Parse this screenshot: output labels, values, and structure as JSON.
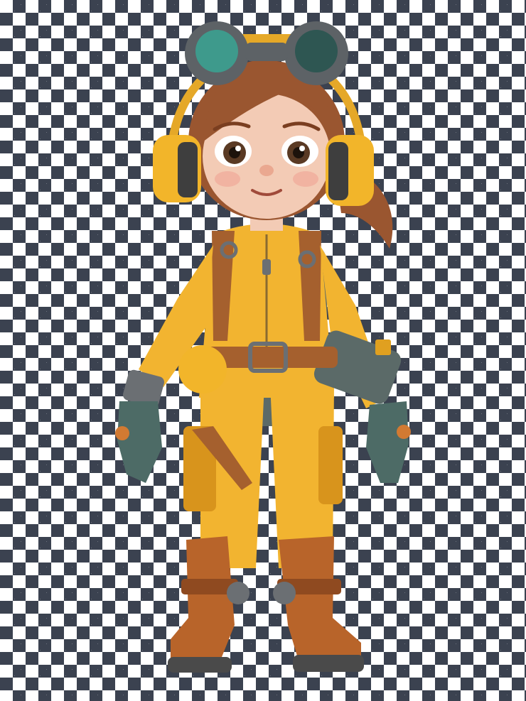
{
  "image": {
    "subject_icon": "character-figure-icon",
    "background_pattern": "checkerboard-transparency",
    "colors": {
      "checker_dark": "#3b4250",
      "checker_light": "#ffffff",
      "suit": "#f2b430",
      "suit_shadow": "#d8941c",
      "hair": "#9a5630",
      "skin": "#f3cbb5",
      "strap": "#a5602e",
      "boot": "#b8642a",
      "glove": "#4d6b66",
      "goggle_frame": "#5d6266",
      "goggle_lens": "#3e9a8c",
      "headphone": "#f2b52a",
      "metal": "#6b6f73"
    }
  }
}
